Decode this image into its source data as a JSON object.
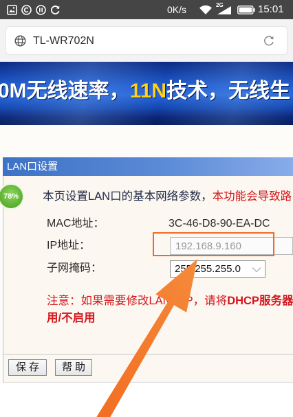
{
  "status_bar": {
    "left_icons": [
      "gallery-icon",
      "circle-c-icon",
      "circle-pause-icon",
      "sync-icon"
    ],
    "network_speed": "0K/s",
    "network_type": "2G",
    "right_icons": [
      "wifi-icon",
      "signal-icon",
      "battery-icon"
    ],
    "time": "15:01"
  },
  "browser": {
    "address": "TL-WR702N",
    "left_icon": "globe-icon",
    "right_icon": "refresh-icon"
  },
  "banner": {
    "text_parts": [
      "0M无线速率，",
      "11N",
      "技术，无线生"
    ]
  },
  "panel": {
    "title": "LAN口设置",
    "badge": "78%",
    "intro": "本页设置LAN口的基本网络参数，",
    "intro_warning": "本功能会导致路",
    "fields": {
      "mac": {
        "label": "MAC地址：",
        "value": "3C-46-D8-90-EA-DC"
      },
      "ip": {
        "label": "IP地址：",
        "value": "192.168.9.160"
      },
      "subnet": {
        "label": "子网掩码：",
        "value": "255.255.255.0"
      }
    },
    "note": "注意：如果需要修改LAN口IP，请将",
    "note_emphasis": "DHCP服务器",
    "note_line2": "用/不启用",
    "buttons": {
      "save": "保存",
      "help": "帮助"
    }
  },
  "colors": {
    "banner_blue": "#1d59cc",
    "banner_highlight": "#ffd21a",
    "header_blue": "#3d72c6",
    "warning_red": "#d4161b",
    "badge_green": "#5aae2f",
    "annotation_orange": "#ef6b23"
  }
}
